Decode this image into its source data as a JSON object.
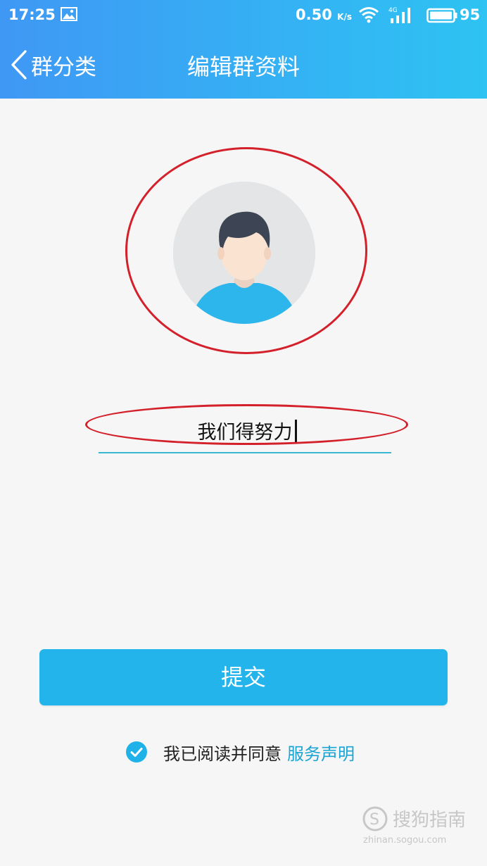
{
  "statusbar": {
    "time": "17:25",
    "net_speed": "0.50",
    "net_unit": "K/s",
    "network_type": "4G",
    "battery": "95"
  },
  "nav": {
    "back_label": "群分类",
    "title": "编辑群资料"
  },
  "avatar": {
    "icon": "default-avatar-icon",
    "bg_color": "#e3e5e7",
    "shirt_color": "#2cb6ec"
  },
  "group_name": {
    "value": "我们得努力"
  },
  "submit": {
    "label": "提交",
    "color": "#23b4ec"
  },
  "agreement": {
    "checked": true,
    "text": "我已阅读并同意",
    "link": "服务声明"
  },
  "watermark": {
    "brand": "搜狗指南",
    "url": "zhinan.sogou.com"
  },
  "colors": {
    "header_start": "#3f98f4",
    "header_end": "#2ec3f2",
    "accent": "#1aa4d6",
    "annotation": "#d4202a"
  }
}
